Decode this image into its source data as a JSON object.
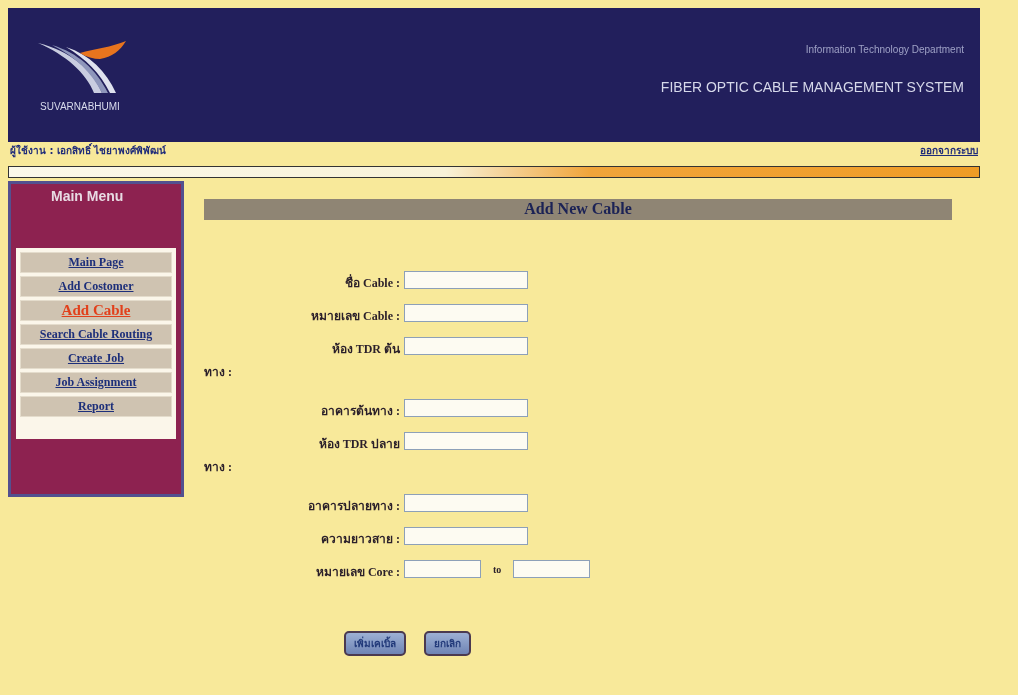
{
  "header": {
    "logo_text": "SUVARNABHUMI",
    "department": "Information Technology Department",
    "system_title": "FIBER OPTIC CABLE MANAGEMENT SYSTEM"
  },
  "user_bar": {
    "user": "ผู้ใช้งาน : เอกสิทธิ์  ไชยาพงศ์พิพัฒน์",
    "logout": "ออกจากระบบ"
  },
  "sidebar": {
    "title": "Main Menu",
    "items": [
      {
        "label": "Main Page",
        "selected": false
      },
      {
        "label": "Add Costomer",
        "selected": false
      },
      {
        "label": "Add Cable",
        "selected": true
      },
      {
        "label": "Search Cable Routing",
        "selected": false
      },
      {
        "label": "Create Job",
        "selected": false
      },
      {
        "label": "Job Assignment",
        "selected": false
      },
      {
        "label": "Report",
        "selected": false
      }
    ]
  },
  "form": {
    "title": "Add New Cable",
    "fields": [
      {
        "kind": "single",
        "label_lines": [
          "ชื่อ Cable :"
        ]
      },
      {
        "kind": "single",
        "label_lines": [
          "หมายเลข Cable :"
        ]
      },
      {
        "kind": "single",
        "label_lines": [
          "ห้อง TDR ต้น",
          "ทาง :"
        ]
      },
      {
        "kind": "single",
        "label_lines": [
          "อาคารต้นทาง :"
        ]
      },
      {
        "kind": "single",
        "label_lines": [
          "ห้อง TDR ปลาย",
          "ทาง :"
        ]
      },
      {
        "kind": "single",
        "label_lines": [
          "อาคารปลายทาง :"
        ]
      },
      {
        "kind": "single",
        "label_lines": [
          "ความยาวสาย :"
        ]
      },
      {
        "kind": "range",
        "label_lines": [
          "หมายเลข Core :"
        ],
        "separator": "to"
      }
    ],
    "buttons": [
      "เพิ่มเคเบิ้ล",
      "ยกเลิก"
    ]
  }
}
